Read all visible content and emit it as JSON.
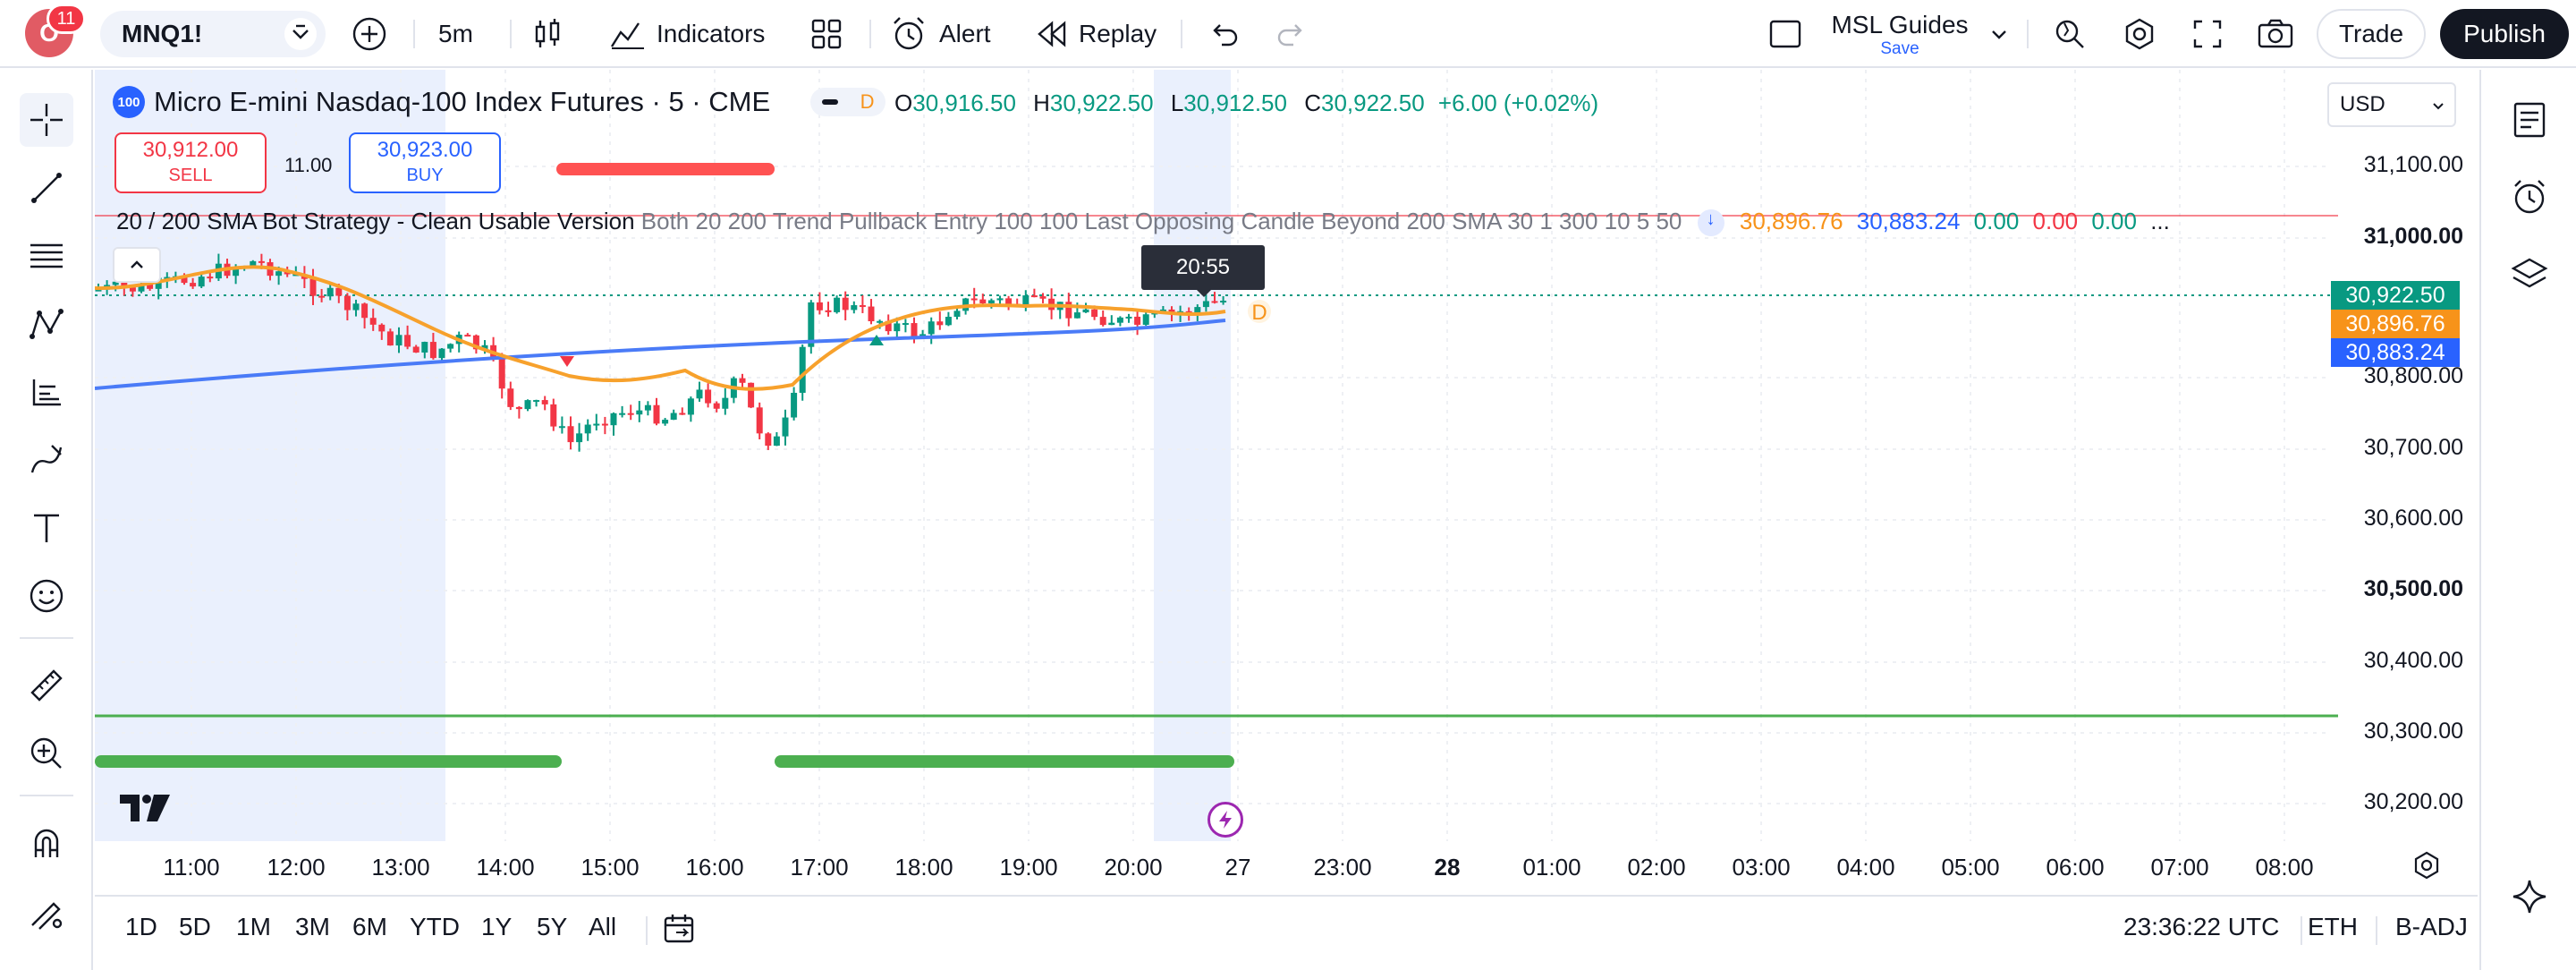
{
  "header": {
    "avatar_letter": "O",
    "notification_count": "11",
    "symbol": "MNQ1!",
    "interval": "5m",
    "indicators_label": "Indicators",
    "alert_label": "Alert",
    "replay_label": "Replay",
    "layout_name": "MSL Guides",
    "layout_save": "Save",
    "trade_label": "Trade",
    "publish_label": "Publish"
  },
  "legend": {
    "badge": "100",
    "title": "Micro E-mini Nasdaq-100 Index Futures · 5 · CME",
    "d_marker": "D",
    "o_label": "O",
    "o_value": "30,916.50",
    "h_label": "H",
    "h_value": "30,922.50",
    "l_label": "L",
    "l_value": "30,912.50",
    "c_label": "C",
    "c_value": "30,922.50",
    "change": "+6.00 (+0.02%)"
  },
  "order": {
    "sell_price": "30,912.00",
    "sell_label": "SELL",
    "spread": "11.00",
    "buy_price": "30,923.00",
    "buy_label": "BUY"
  },
  "strategy": {
    "name": "20 / 200 SMA Bot Strategy - Clean Usable Version",
    "params": "Both 20 200 Trend Pullback Entry 100 100 Last Opposing Candle Beyond 200 SMA 30 1 300 10 5 50",
    "v1": "30,896.76",
    "v2": "30,883.24",
    "v3": "0.00",
    "v4": "0.00",
    "v5": "0.00",
    "more": "..."
  },
  "tooltip": {
    "time": "20:55"
  },
  "currency": "USD",
  "price_axis": [
    {
      "label": "31,100.00",
      "bold": false
    },
    {
      "label": "31,000.00",
      "bold": true
    },
    {
      "label": "30,800.00",
      "bold": false
    },
    {
      "label": "30,700.00",
      "bold": false
    },
    {
      "label": "30,600.00",
      "bold": false
    },
    {
      "label": "30,500.00",
      "bold": true
    },
    {
      "label": "30,400.00",
      "bold": false
    },
    {
      "label": "30,300.00",
      "bold": false
    },
    {
      "label": "30,200.00",
      "bold": false
    }
  ],
  "price_tags": [
    {
      "label": "30,922.50",
      "color": "#089981"
    },
    {
      "label": "30,896.76",
      "color": "#f7931a"
    },
    {
      "label": "30,883.24",
      "color": "#2962ff"
    }
  ],
  "time_axis": [
    "11:00",
    "12:00",
    "13:00",
    "14:00",
    "15:00",
    "16:00",
    "17:00",
    "18:00",
    "19:00",
    "20:00",
    "27",
    "23:00",
    "28",
    "01:00",
    "02:00",
    "03:00",
    "04:00",
    "05:00",
    "06:00",
    "07:00",
    "08:00"
  ],
  "bottom": {
    "ranges": [
      "1D",
      "5D",
      "1M",
      "3M",
      "6M",
      "YTD",
      "1Y",
      "5Y",
      "All"
    ],
    "clock": "23:36:22 UTC",
    "session": "ETH",
    "adjust": "B-ADJ"
  },
  "colors": {
    "up": "#089981",
    "down": "#f23645",
    "sma20": "#f7a12c",
    "sma200": "#4a7bf7",
    "green_line": "#4caf50",
    "session_shade": "#eaf0fd"
  }
}
